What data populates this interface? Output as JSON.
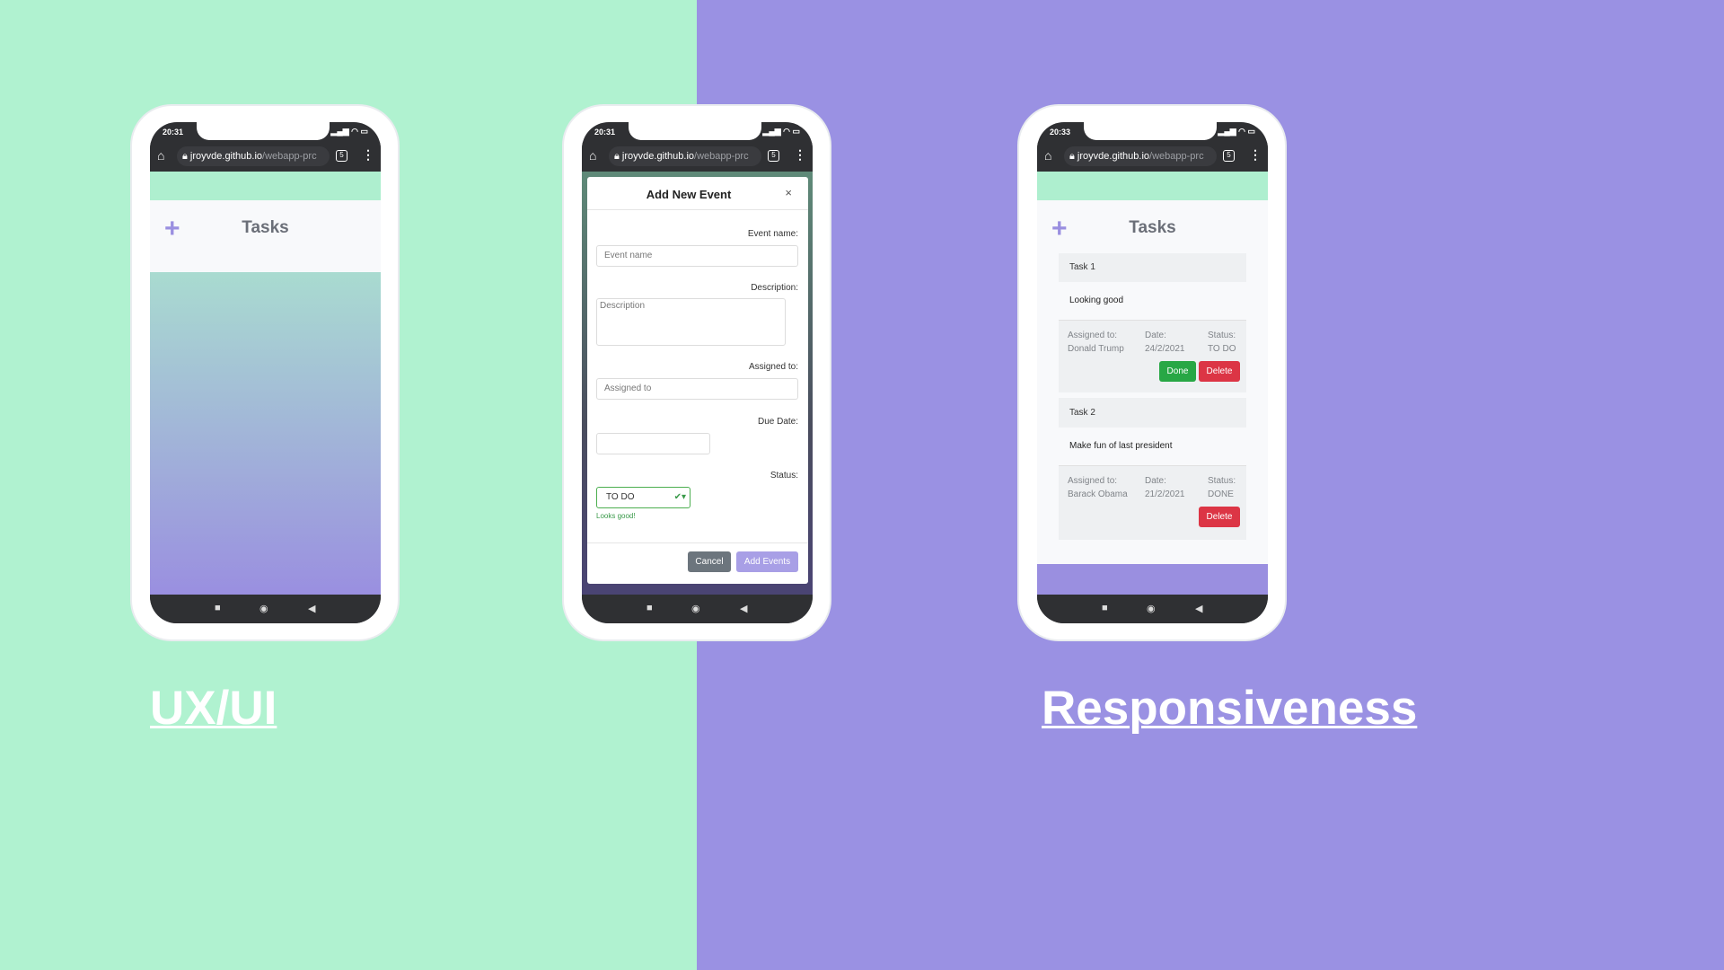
{
  "colors": {
    "left_bg": "#b0f2d0",
    "right_bg": "#9a91e3",
    "accent": "#9a8fe0",
    "done": "#28a745",
    "delete": "#dc3545"
  },
  "browser": {
    "url_host": "jroyvde.github.io",
    "url_path": "/webapp-prc",
    "tab_count": "5",
    "home_icon": "home-icon",
    "lock_icon": "lock-icon",
    "menu_icon": "kebab-menu-icon"
  },
  "phones": [
    {
      "time": "20:31",
      "app_title": "Tasks"
    },
    {
      "time": "20:31",
      "modal": {
        "title": "Add New Event",
        "close": "×",
        "event_name_label": "Event name:",
        "event_name_placeholder": "Event name",
        "description_label": "Description:",
        "description_placeholder": "Description",
        "assigned_label": "Assigned to:",
        "assigned_placeholder": "Assigned to",
        "due_date_label": "Due Date:",
        "status_label": "Status:",
        "status_value": "TO DO",
        "validation": "Looks good!",
        "cancel": "Cancel",
        "submit": "Add Events"
      }
    },
    {
      "time": "20:33",
      "app_title": "Tasks",
      "tasks": [
        {
          "title": "Task 1",
          "description": "Looking good",
          "assigned_label": "Assigned to:",
          "assigned": "Donald Trump",
          "date_label": "Date:",
          "date": "24/2/2021",
          "status_label": "Status:",
          "status": "TO DO",
          "done": "Done",
          "delete": "Delete"
        },
        {
          "title": "Task 2",
          "description": "Make fun of last president",
          "assigned_label": "Assigned to:",
          "assigned": "Barack Obama",
          "date_label": "Date:",
          "date": "21/2/2021",
          "status_label": "Status:",
          "status": "DONE",
          "delete": "Delete"
        }
      ]
    }
  ],
  "labels": {
    "left": "UX/UI",
    "right": "Responsiveness"
  }
}
